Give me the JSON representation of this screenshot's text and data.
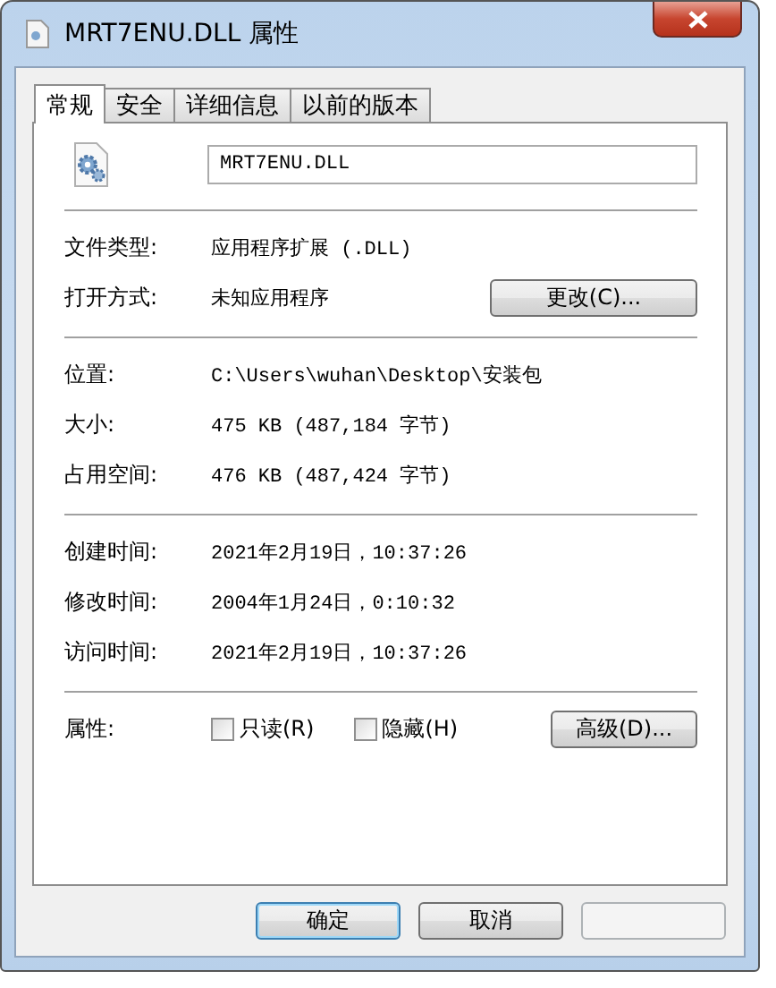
{
  "window": {
    "title": "MRT7ENU.DLL 属性"
  },
  "tabs": [
    {
      "label": "常规",
      "selected": true
    },
    {
      "label": "安全",
      "selected": false
    },
    {
      "label": "详细信息",
      "selected": false
    },
    {
      "label": "以前的版本",
      "selected": false
    }
  ],
  "file_name": "MRT7ENU.DLL",
  "groups": [
    [
      {
        "label": "文件类型:",
        "value": "应用程序扩展 (.DLL)"
      },
      {
        "label": "打开方式:",
        "value": "未知应用程序",
        "button": "更改(C)..."
      }
    ],
    [
      {
        "label": "位置:",
        "value": "C:\\Users\\wuhan\\Desktop\\安装包"
      },
      {
        "label": "大小:",
        "value": "475 KB (487,184 字节)"
      },
      {
        "label": "占用空间:",
        "value": "476 KB (487,424 字节)"
      }
    ],
    [
      {
        "label": "创建时间:",
        "value": "2021年2月19日，10:37:26"
      },
      {
        "label": "修改时间:",
        "value": "2004年1月24日，0:10:32"
      },
      {
        "label": "访问时间:",
        "value": "2021年2月19日，10:37:26"
      }
    ]
  ],
  "attributes": {
    "label": "属性:",
    "checkboxes": [
      {
        "label": "只读(R)",
        "checked": false
      },
      {
        "label": "隐藏(H)",
        "checked": false
      }
    ],
    "button": "高级(D)..."
  },
  "buttons": [
    {
      "label": "确定",
      "default": true,
      "disabled": false
    },
    {
      "label": "取消",
      "default": false,
      "disabled": false
    },
    {
      "default": false,
      "disabled": true
    }
  ]
}
